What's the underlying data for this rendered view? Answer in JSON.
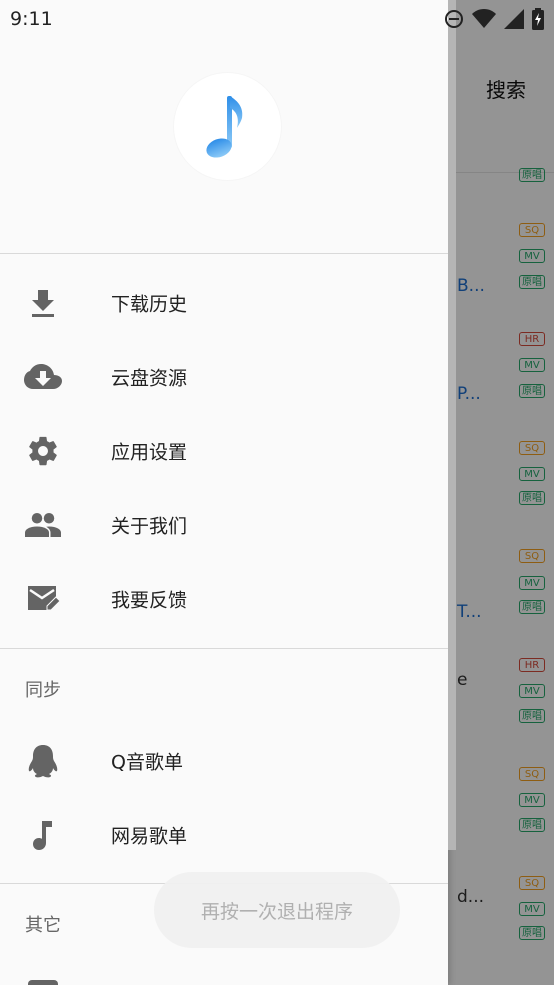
{
  "status_bar": {
    "time": "9:11"
  },
  "background": {
    "search_label": "搜索",
    "rows": [
      {
        "text": "B..."
      },
      {
        "text": "P..."
      },
      {
        "text": "T..."
      },
      {
        "text": "e"
      },
      {
        "text": "d..."
      }
    ],
    "tags": {
      "sq": "SQ",
      "hr": "HR",
      "mv": "MV",
      "original": "原唱"
    }
  },
  "drawer": {
    "menu": [
      {
        "label": "下载历史",
        "icon": "download-icon"
      },
      {
        "label": "云盘资源",
        "icon": "cloud-download-icon"
      },
      {
        "label": "应用设置",
        "icon": "gear-icon"
      },
      {
        "label": "关于我们",
        "icon": "people-icon"
      },
      {
        "label": "我要反馈",
        "icon": "mail-edit-icon"
      }
    ],
    "sync": {
      "section_label": "同步",
      "items": [
        {
          "label": "Q音歌单",
          "icon": "qq-penguin-icon"
        },
        {
          "label": "网易歌单",
          "icon": "music-note-icon"
        }
      ]
    },
    "other": {
      "section_label": "其它"
    }
  },
  "toast": {
    "text": "再按一次退出程序"
  },
  "colors": {
    "accent": "#4aa3ee",
    "icon": "#646464"
  }
}
